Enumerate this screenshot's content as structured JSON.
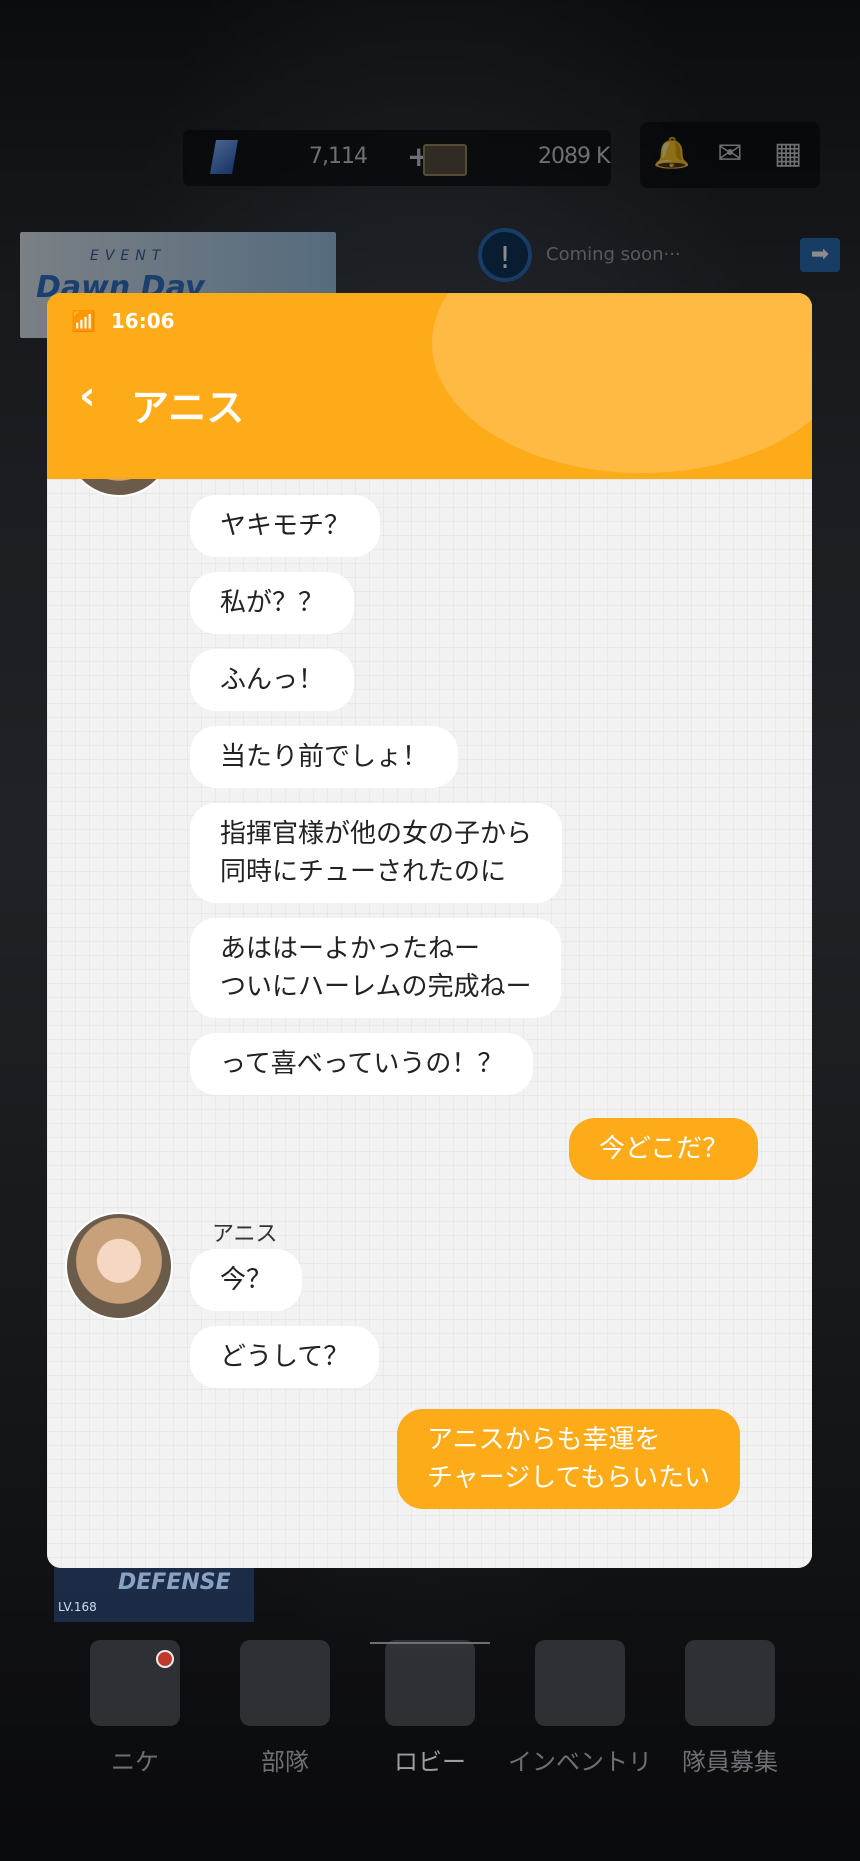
{
  "hud": {
    "gems": "7,114",
    "gems_plus": "+",
    "credits": "2089 K"
  },
  "event_banner": {
    "line1": "EVENT",
    "line2": "Dawn Day"
  },
  "notice": {
    "text": "Coming soon···"
  },
  "phone": {
    "time": "16:06",
    "title": "アニス",
    "messages": [
      {
        "from": "anis",
        "text": "ヤキモチ？"
      },
      {
        "from": "anis",
        "text": "私が？？"
      },
      {
        "from": "anis",
        "text": "ふんっ！"
      },
      {
        "from": "anis",
        "text": "当たり前でしょ！"
      },
      {
        "from": "anis",
        "text": "指揮官様が他の女の子から\n同時にチューされたのに"
      },
      {
        "from": "anis",
        "text": "あははーよかったねー\nついにハーレムの完成ねー"
      },
      {
        "from": "anis",
        "text": "って喜べっていうの！？"
      },
      {
        "from": "me",
        "text": "今どこだ？"
      },
      {
        "from": "anis",
        "sender": "アニス",
        "text": "今？"
      },
      {
        "from": "anis",
        "text": "どうして？"
      },
      {
        "from": "me",
        "text": "アニスからも幸運を\nチャージしてもらいたい"
      }
    ]
  },
  "defense": {
    "level": "LV.168",
    "label": "DEFENSE"
  },
  "bottom_nav": [
    {
      "label": "ニケ",
      "badge": true
    },
    {
      "label": "部隊"
    },
    {
      "label": "ロビー",
      "active": true
    },
    {
      "label": "インベントリ"
    },
    {
      "label": "隊員募集"
    }
  ]
}
